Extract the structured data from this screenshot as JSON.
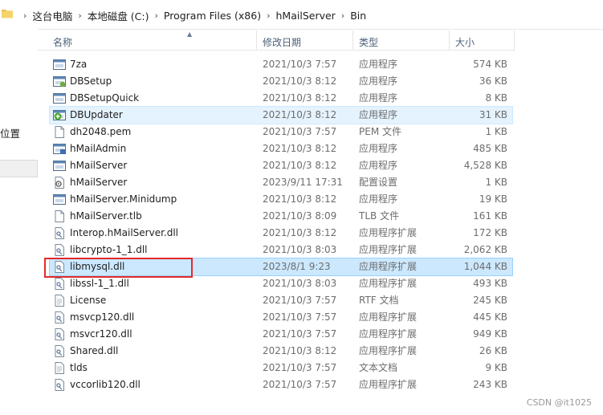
{
  "breadcrumb": [
    "这台电脑",
    "本地磁盘 (C:)",
    "Program Files (x86)",
    "hMailServer",
    "Bin"
  ],
  "navpane": {
    "location_label": "位置"
  },
  "columns": {
    "name": "名称",
    "date": "修改日期",
    "type": "类型",
    "size": "大小"
  },
  "files": [
    {
      "name": "7za",
      "date": "2021/10/3 7:57",
      "type": "应用程序",
      "size": "574 KB",
      "icon": "app-icon"
    },
    {
      "name": "DBSetup",
      "date": "2021/10/3 8:12",
      "type": "应用程序",
      "size": "36 KB",
      "icon": "setup-app-icon"
    },
    {
      "name": "DBSetupQuick",
      "date": "2021/10/3 8:12",
      "type": "应用程序",
      "size": "8 KB",
      "icon": "app-icon"
    },
    {
      "name": "DBUpdater",
      "date": "2021/10/3 8:12",
      "type": "应用程序",
      "size": "31 KB",
      "icon": "updater-app-icon"
    },
    {
      "name": "dh2048.pem",
      "date": "2021/10/3 7:57",
      "type": "PEM 文件",
      "size": "1 KB",
      "icon": "blank-file-icon"
    },
    {
      "name": "hMailAdmin",
      "date": "2021/10/3 8:12",
      "type": "应用程序",
      "size": "485 KB",
      "icon": "admin-app-icon"
    },
    {
      "name": "hMailServer",
      "date": "2021/10/3 8:12",
      "type": "应用程序",
      "size": "4,528 KB",
      "icon": "app-icon"
    },
    {
      "name": "hMailServer",
      "date": "2023/9/11 17:31",
      "type": "配置设置",
      "size": "1 KB",
      "icon": "config-file-icon"
    },
    {
      "name": "hMailServer.Minidump",
      "date": "2021/10/3 8:12",
      "type": "应用程序",
      "size": "19 KB",
      "icon": "app-icon"
    },
    {
      "name": "hMailServer.tlb",
      "date": "2021/10/3 8:09",
      "type": "TLB 文件",
      "size": "161 KB",
      "icon": "blank-file-icon"
    },
    {
      "name": "Interop.hMailServer.dll",
      "date": "2021/10/3 8:12",
      "type": "应用程序扩展",
      "size": "172 KB",
      "icon": "dll-file-icon"
    },
    {
      "name": "libcrypto-1_1.dll",
      "date": "2021/10/3 8:03",
      "type": "应用程序扩展",
      "size": "2,062 KB",
      "icon": "dll-file-icon"
    },
    {
      "name": "libmysql.dll",
      "date": "2023/8/1 9:23",
      "type": "应用程序扩展",
      "size": "1,044 KB",
      "icon": "dll-file-icon"
    },
    {
      "name": "libssl-1_1.dll",
      "date": "2021/10/3 8:03",
      "type": "应用程序扩展",
      "size": "493 KB",
      "icon": "dll-file-icon"
    },
    {
      "name": "License",
      "date": "2021/10/3 7:57",
      "type": "RTF 文档",
      "size": "245 KB",
      "icon": "text-file-icon"
    },
    {
      "name": "msvcp120.dll",
      "date": "2021/10/3 7:57",
      "type": "应用程序扩展",
      "size": "445 KB",
      "icon": "dll-file-icon"
    },
    {
      "name": "msvcr120.dll",
      "date": "2021/10/3 7:57",
      "type": "应用程序扩展",
      "size": "949 KB",
      "icon": "dll-file-icon"
    },
    {
      "name": "Shared.dll",
      "date": "2021/10/3 8:12",
      "type": "应用程序扩展",
      "size": "26 KB",
      "icon": "dll-file-icon"
    },
    {
      "name": "tlds",
      "date": "2021/10/3 7:57",
      "type": "文本文档",
      "size": "9 KB",
      "icon": "text-file-icon"
    },
    {
      "name": "vccorlib120.dll",
      "date": "2021/10/3 7:57",
      "type": "应用程序扩展",
      "size": "243 KB",
      "icon": "dll-file-icon"
    }
  ],
  "selected_index": 12,
  "hover_index": 3,
  "watermark": "CSDN @it1025",
  "colors": {
    "selection": "#cce8ff",
    "highlight_box": "#e32a2a",
    "header_text": "#4c607a"
  }
}
